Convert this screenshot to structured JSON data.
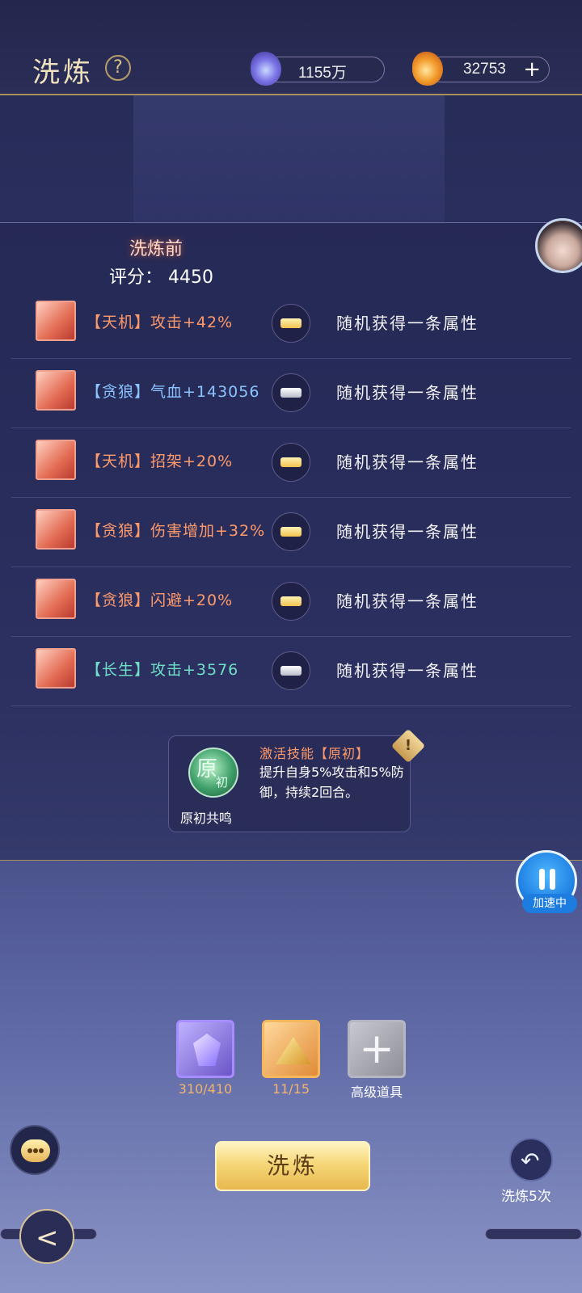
{
  "header": {
    "title": "洗炼",
    "help_icon": "?",
    "resource1": {
      "icon": "spirit-gem-icon",
      "value": "1155万"
    },
    "resource2": {
      "icon": "flame-token-icon",
      "value": "32753",
      "plus": "+"
    }
  },
  "before": {
    "title": "洗炼前",
    "score_label": "评分：",
    "score_value": "4450"
  },
  "attributes": [
    {
      "name": "【天机】攻击+42%",
      "lock": "gold",
      "result": "随机获得一条属性"
    },
    {
      "name": "【贪狼】气血+143056",
      "lock": "silver",
      "result": "随机获得一条属性"
    },
    {
      "name": "【天机】招架+20%",
      "lock": "gold",
      "result": "随机获得一条属性"
    },
    {
      "name": "【贪狼】伤害增加+32%",
      "lock": "gold",
      "result": "随机获得一条属性"
    },
    {
      "name": "【贪狼】闪避+20%",
      "lock": "gold",
      "result": "随机获得一条属性"
    },
    {
      "name": "【长生】攻击+3576",
      "lock": "silver",
      "result": "随机获得一条属性"
    }
  ],
  "skill": {
    "badge_main": "原",
    "badge_sub": "初",
    "name": "原初共鸣",
    "title": "激活技能【原初】",
    "desc": "提升自身5%攻击和5%防御，持续2回合。",
    "warn": "!"
  },
  "speed": {
    "label": "加速中"
  },
  "items": [
    {
      "icon": "purple-crystal-icon",
      "label": "310/410"
    },
    {
      "icon": "gold-pyramid-icon",
      "label": "11/15"
    },
    {
      "icon": "add-plus-icon",
      "label": "高级道具",
      "glyph": "+"
    }
  ],
  "actions": {
    "wash": "洗炼",
    "wash_five": "洗炼5次",
    "five_icon": "↶",
    "back_icon": "<"
  },
  "colors": {
    "gold": "#f5d778",
    "accent_orange": "#ff9a6a",
    "accent_blue": "#8cc4ff",
    "accent_green": "#6fe0c6"
  }
}
